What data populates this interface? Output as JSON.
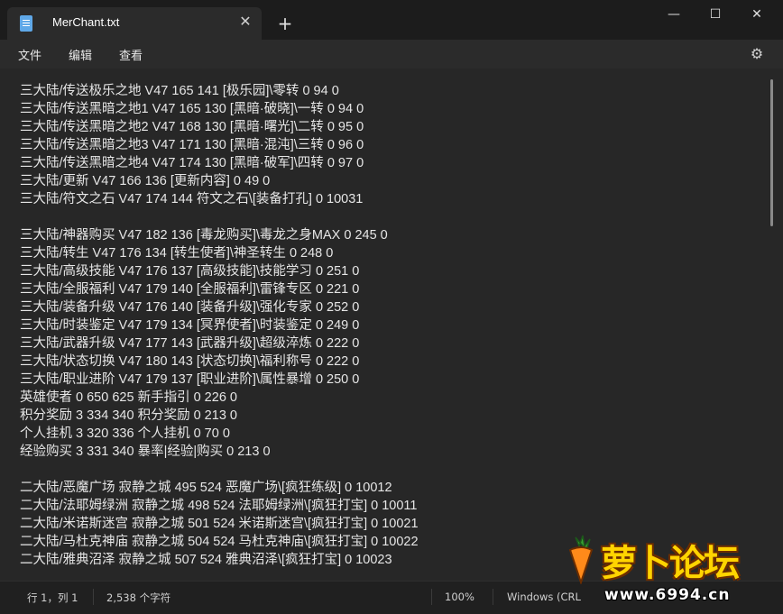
{
  "titlebar": {
    "tab_title": "MerChant.txt",
    "close_tab": "✕",
    "new_tab": "+",
    "minimize": "—",
    "maximize": "☐",
    "close_window": "✕"
  },
  "menu": {
    "items": [
      "文件",
      "编辑",
      "查看"
    ]
  },
  "editor": {
    "lines": [
      "三大陆/传送极乐之地 V47 165 141 [极乐园]\\零转 0 94 0",
      "三大陆/传送黑暗之地1 V47 165 130 [黑暗·破晓]\\一转 0 94 0",
      "三大陆/传送黑暗之地2 V47 168 130 [黑暗·曙光]\\二转 0 95 0",
      "三大陆/传送黑暗之地3 V47 171 130 [黑暗·混沌]\\三转 0 96 0",
      "三大陆/传送黑暗之地4 V47 174 130 [黑暗·破军]\\四转 0 97 0",
      "三大陆/更新 V47 166 136 [更新内容] 0 49 0",
      "三大陆/符文之石 V47 174 144 符文之石\\[装备打孔] 0 10031",
      "",
      "三大陆/神器购买 V47 182 136 [毒龙购买]\\毒龙之身MAX 0 245 0",
      "三大陆/转生 V47 176 134 [转生使者]\\神圣转生 0 248 0",
      "三大陆/高级技能 V47 176 137 [高级技能]\\技能学习 0 251 0",
      "三大陆/全服福利 V47 179 140 [全服福利]\\雷锋专区 0 221 0",
      "三大陆/装备升级 V47 176 140 [装备升级]\\强化专家 0 252 0",
      "三大陆/时装鉴定 V47 179 134 [冥界使者]\\时装鉴定 0 249 0",
      "三大陆/武器升级 V47 177 143 [武器升级]\\超级淬炼 0 222 0",
      "三大陆/状态切换 V47 180 143 [状态切换]\\福利称号 0 222 0",
      "三大陆/职业进阶 V47 179 137 [职业进阶]\\属性暴增 0 250 0",
      "英雄使者 0 650 625 新手指引 0 226 0",
      "积分奖励 3 334 340 积分奖励 0 213 0",
      "个人挂机 3 320 336 个人挂机 0 70 0",
      "经验购买 3 331 340 暴率|经验|购买 0 213 0",
      "",
      "二大陆/恶魔广场 寂静之城 495 524 恶魔广场\\[疯狂练级] 0 10012",
      "二大陆/法耶姆绿洲 寂静之城 498 524 法耶姆绿洲\\[疯狂打宝] 0 10011",
      "二大陆/米诺斯迷宫 寂静之城 501 524 米诺斯迷宫\\[疯狂打宝] 0 10021",
      "二大陆/马杜克神庙 寂静之城 504 524 马杜克神庙\\[疯狂打宝] 0 10022",
      "二大陆/雅典沼泽 寂静之城 507 524 雅典沼泽\\[疯狂打宝] 0 10023"
    ]
  },
  "status": {
    "position": "行 1，列 1",
    "char_count": "2,538 个字符",
    "zoom": "100%",
    "line_ending": "Windows (CRL"
  },
  "watermark": {
    "brand": "萝卜论坛",
    "url": "www.6994.cn"
  },
  "icons": {
    "notepad": "notepad-icon",
    "settings": "gear-icon"
  },
  "colors": {
    "background": "#202020",
    "editor": "#272727",
    "text": "#e6e6e6",
    "watermark": "#ffd400"
  }
}
